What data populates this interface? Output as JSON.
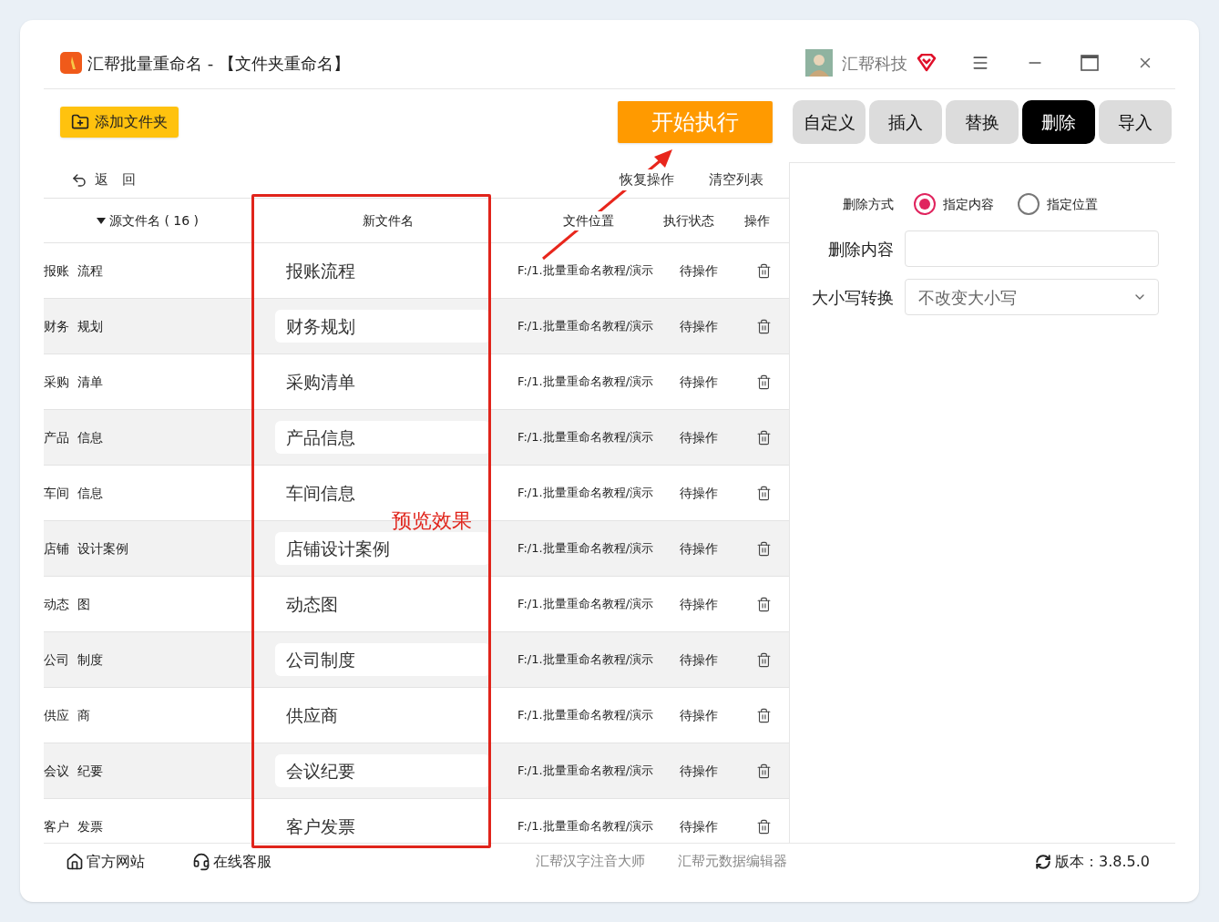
{
  "window": {
    "title": "汇帮批量重命名 - 【文件夹重命名】",
    "user": "汇帮科技"
  },
  "toolbar": {
    "add_button": "添加文件夹",
    "start_button": "开始执行",
    "back": "返　回",
    "actions": [
      "恢复操作",
      "清空列表"
    ]
  },
  "tabs": [
    {
      "label": "自定义",
      "selected": false
    },
    {
      "label": "插入",
      "selected": false
    },
    {
      "label": "替换",
      "selected": false
    },
    {
      "label": "删除",
      "selected": true
    },
    {
      "label": "导入",
      "selected": false
    }
  ],
  "table": {
    "columns": [
      "源文件名 ( 16 )",
      "新文件名",
      "文件位置",
      "执行状态",
      "操作"
    ],
    "rows": [
      {
        "source": "报账  流程",
        "new_name": "报账流程",
        "location": "F:/1.批量重命名教程/演示",
        "status": "待操作"
      },
      {
        "source": "财务  规划",
        "new_name": "财务规划",
        "location": "F:/1.批量重命名教程/演示",
        "status": "待操作"
      },
      {
        "source": "采购  清单",
        "new_name": "采购清单",
        "location": "F:/1.批量重命名教程/演示",
        "status": "待操作"
      },
      {
        "source": "产品  信息",
        "new_name": "产品信息",
        "location": "F:/1.批量重命名教程/演示",
        "status": "待操作"
      },
      {
        "source": "车间  信息",
        "new_name": "车间信息",
        "location": "F:/1.批量重命名教程/演示",
        "status": "待操作"
      },
      {
        "source": "店铺  设计案例",
        "new_name": "店铺设计案例",
        "location": "F:/1.批量重命名教程/演示",
        "status": "待操作"
      },
      {
        "source": "动态  图",
        "new_name": "动态图",
        "location": "F:/1.批量重命名教程/演示",
        "status": "待操作"
      },
      {
        "source": "公司  制度",
        "new_name": "公司制度",
        "location": "F:/1.批量重命名教程/演示",
        "status": "待操作"
      },
      {
        "source": "供应  商",
        "new_name": "供应商",
        "location": "F:/1.批量重命名教程/演示",
        "status": "待操作"
      },
      {
        "source": "会议  纪要",
        "new_name": "会议纪要",
        "location": "F:/1.批量重命名教程/演示",
        "status": "待操作"
      },
      {
        "source": "客户  发票",
        "new_name": "客户发票",
        "location": "F:/1.批量重命名教程/演示",
        "status": "待操作"
      }
    ]
  },
  "delete_panel": {
    "mode_label": "删除方式",
    "modes": [
      {
        "label": "指定内容",
        "selected": true
      },
      {
        "label": "指定位置",
        "selected": false
      }
    ],
    "content_label": "删除内容",
    "case_label": "大小写转换",
    "case_value": "不改变大小写"
  },
  "footer": {
    "links": [
      "官方网站",
      "在线客服"
    ],
    "apps": [
      "汇帮汉字注音大师",
      "汇帮元数据编辑器"
    ],
    "version": "版本：3.8.5.0"
  },
  "annotation": {
    "label": "预览效果"
  }
}
